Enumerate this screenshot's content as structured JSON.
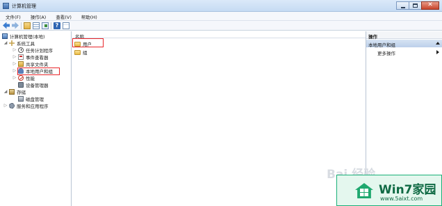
{
  "window": {
    "title": "计算机管理"
  },
  "menu": [
    "文件(F)",
    "操作(A)",
    "查看(V)",
    "帮助(H)"
  ],
  "toolbar": {
    "icons": [
      "back-arrow-icon",
      "forward-arrow-icon",
      "up-folder-icon",
      "show-hide-tree-icon",
      "export-list-icon",
      "help-icon",
      "view-icon"
    ]
  },
  "tree": {
    "root": "计算机管理(本地)",
    "system_tools": "系统工具",
    "task_scheduler": "任务计划程序",
    "event_viewer": "事件查看器",
    "shared_folders": "共享文件夹",
    "local_users_groups": "本地用户和组",
    "performance": "性能",
    "device_manager": "设备管理器",
    "storage": "存储",
    "disk_management": "磁盘管理",
    "services_apps": "服务和应用程序"
  },
  "list": {
    "column_name": "名称",
    "items": [
      "用户",
      "组"
    ]
  },
  "actions": {
    "header": "操作",
    "section": "本地用户和组",
    "more": "更多操作"
  },
  "watermark": {
    "text": "Bai 经验",
    "brand_name": "Win7家园",
    "brand_url": "www.5aixt.com"
  },
  "colors": {
    "highlight_box": "#e8262a",
    "brand_green": "#1fa86f"
  }
}
